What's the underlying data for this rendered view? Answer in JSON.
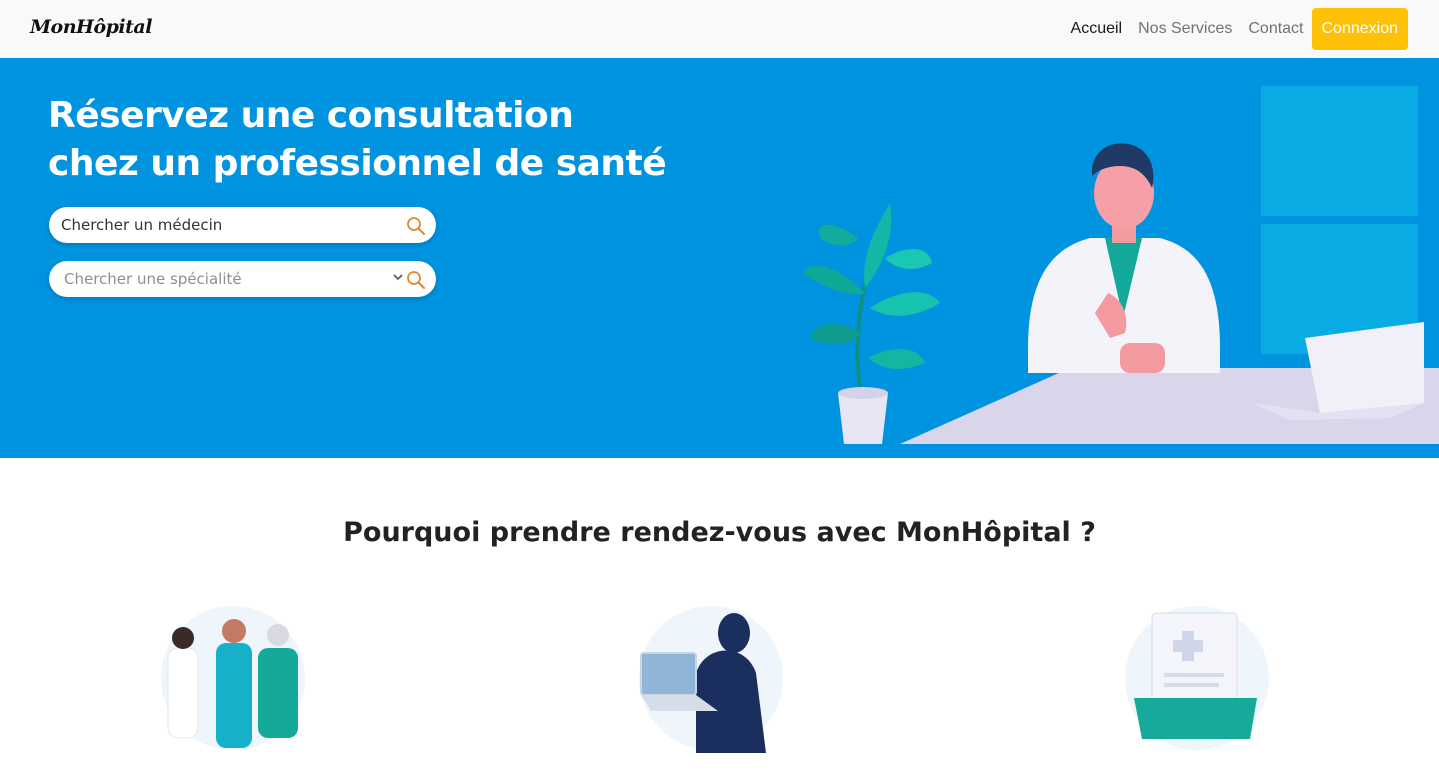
{
  "brand": "MonHôpital",
  "nav": {
    "links": [
      {
        "label": "Accueil",
        "active": true
      },
      {
        "label": "Nos Services",
        "active": false
      },
      {
        "label": "Contact",
        "active": false
      }
    ],
    "login_label": "Connexion"
  },
  "hero": {
    "title_line1": "Réservez une consultation",
    "title_line2": "chez un professionnel de santé",
    "search_doctor_placeholder": "Chercher un médecin",
    "search_specialty_placeholder": "Chercher une spécialité"
  },
  "section": {
    "title": "Pourquoi prendre rendez-vous avec MonHôpital ?"
  },
  "colors": {
    "hero_bg": "#0093e0",
    "accent": "#ffc107",
    "navbar_bg": "#f8f9fa",
    "teal": "#14b1a4"
  }
}
